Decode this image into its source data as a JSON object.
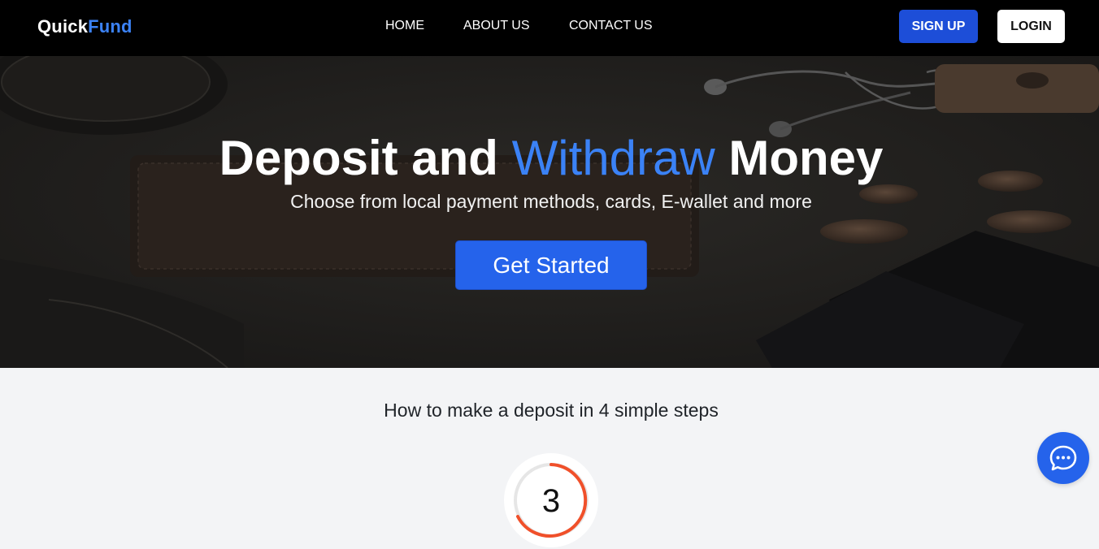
{
  "brand": {
    "name_part1": "Quick",
    "name_part2": "Fund",
    "accent_color": "#3b82f6"
  },
  "nav": {
    "links": [
      {
        "label": "HOME"
      },
      {
        "label": "ABOUT US"
      },
      {
        "label": "CONTACT US"
      }
    ],
    "signup_label": "SIGN UP",
    "login_label": "LOGIN"
  },
  "hero": {
    "title_part1": "Deposit and ",
    "title_accent": "Withdraw",
    "title_part2": " Money",
    "subtitle": "Choose from local payment methods, cards, E-wallet and more",
    "cta_label": "Get Started"
  },
  "steps": {
    "heading": "How to make a deposit in 4 simple steps",
    "current_step": "3",
    "ring_color": "#f0502a"
  },
  "chat": {
    "icon": "chat-bubble-icon",
    "color": "#2563eb"
  },
  "colors": {
    "primary": "#2563eb",
    "signup": "#1d4ed8",
    "nav_bg": "#000000",
    "page_bg": "#f3f4f6"
  }
}
